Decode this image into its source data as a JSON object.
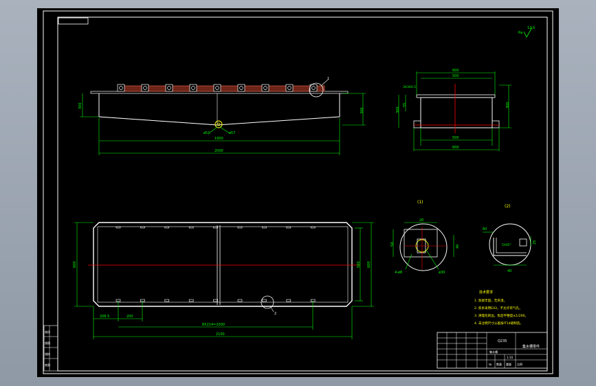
{
  "colors": {
    "background": "#000000",
    "outline": "#ffffff",
    "dimension": "#00ff00",
    "centerline": "#ff0000",
    "detail": "#ffff00",
    "rails": "#c8553d"
  },
  "front_view": {
    "dim_height_left": "300",
    "dim_height_right": "300",
    "dim_inner_length": "1950",
    "dim_total_length": "2000",
    "label_left": "ø51",
    "label_right": "ø57",
    "balloon": "1"
  },
  "side_view": {
    "dim_top_width": "600",
    "dim_inner_width": "500",
    "dim_flange": "3X3X0.5",
    "dim_left_height": "300",
    "dim_left_small": "55",
    "dim_right_height": "300",
    "dim_bottom_inner": "500",
    "dim_bottom_width": "600"
  },
  "plan_view": {
    "dim_left_height": "600",
    "dim_right_height": "560",
    "dim_far_right_height": "600",
    "dim_left_offset": "206.5",
    "dim_small": "200",
    "dim_spacing": "8X214=2000",
    "dim_total": "2100",
    "balloon": "2"
  },
  "detail_1": {
    "title": "(1)",
    "dim_top": "20",
    "dim_left": "54",
    "dim_right": "40",
    "label_left": "4-ø8",
    "label_right": "ø30"
  },
  "detail_2": {
    "title": "(2)",
    "dim_left": "60",
    "dim_inner": "5X45°",
    "dim_right": "25",
    "dim_bottom": "40"
  },
  "roughness": "12.5",
  "notes": {
    "title": "技术要求",
    "items": [
      "1. 焦接牢固，无夹渣。",
      "2. 焦条采用E43，不允许有气孔。",
      "3. 清理毛刺边，焦后平整度≤1/200。",
      "4. 未注明尺寸公差按IT14级制造。"
    ]
  },
  "title_block": {
    "part_name": "集水槽",
    "drawing_title": "集水槽零件",
    "material": "Q235",
    "scale": "1:10",
    "sheet_marks": [
      "№",
      "数量",
      "重量",
      "比例"
    ],
    "side_labels": [
      "借用",
      "描图",
      "描校",
      "底图"
    ]
  },
  "tag_box": ""
}
